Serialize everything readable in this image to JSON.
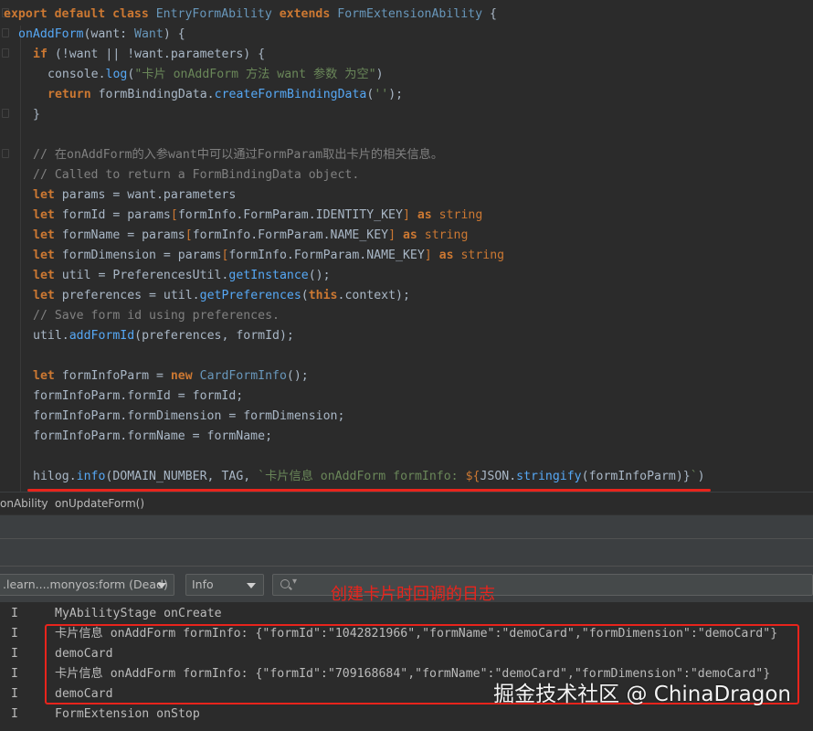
{
  "code": {
    "l1": {
      "k1": "export default class ",
      "c1": "EntryFormAbility ",
      "k2": "extends ",
      "c2": "FormExtensionAbility ",
      "p": "{"
    },
    "l2": {
      "f": "onAddForm",
      "p1": "(want: ",
      "t": "Want",
      "p2": ") {"
    },
    "l3": {
      "k": "if ",
      "p": "(!want || !want.parameters) {"
    },
    "l4": {
      "a": "console.",
      "f": "log",
      "p1": "(",
      "s": "\"卡片 onAddForm 方法 want 参数 为空\"",
      "p2": ")"
    },
    "l5": {
      "k": "return ",
      "a": "formBindingData.",
      "f": "createFormBindingData",
      "p1": "(",
      "s": "''",
      "p2": ");"
    },
    "l6": {
      "p": "}"
    },
    "l8": "// 在onAddForm的入参want中可以通过FormParam取出卡片的相关信息。",
    "l9": "// Called to return a FormBindingData object.",
    "l10": {
      "k": "let ",
      "a": "params = want.parameters"
    },
    "l11": {
      "k": "let ",
      "a": "formId = params",
      "b1": "[",
      "c": "formInfo.FormParam.IDENTITY_KEY",
      "b2": "] ",
      "k2": "as ",
      "t": "string"
    },
    "l12": {
      "k": "let ",
      "a": "formName = params",
      "b1": "[",
      "c": "formInfo.FormParam.NAME_KEY",
      "b2": "] ",
      "k2": "as ",
      "t": "string"
    },
    "l13": {
      "k": "let ",
      "a": "formDimension = params",
      "b1": "[",
      "c": "formInfo.FormParam.NAME_KEY",
      "b2": "] ",
      "k2": "as ",
      "t": "string"
    },
    "l14": {
      "k": "let ",
      "a": "util = PreferencesUtil.",
      "f": "getInstance",
      "p": "();"
    },
    "l15": {
      "k": "let ",
      "a": "preferences = util.",
      "f": "getPreferences",
      "p1": "(",
      "k2": "this",
      "p2": ".context);"
    },
    "l16": "// Save form id using preferences.",
    "l17": {
      "a": "util.",
      "f": "addFormId",
      "p": "(preferences, formId);"
    },
    "l19": {
      "k": "let ",
      "a": "formInfoParm = ",
      "k2": "new ",
      "c": "CardFormInfo",
      "p": "();"
    },
    "l20": "formInfoParm.formId = formId;",
    "l21": "formInfoParm.formDimension = formDimension;",
    "l22": "formInfoParm.formName = formName;",
    "l24": {
      "a": "hilog.",
      "f": "info",
      "p1": "(DOMAIN_NUMBER, TAG, ",
      "s1": "`卡片信息 onAddForm formInfo: ",
      "i1": "${",
      "j": "JSON.",
      "f2": "stringify",
      "i2": "(formInfoParm)}",
      "s2": "`",
      "p2": ")"
    }
  },
  "breadcrumb": {
    "item1": "onAbility",
    "sep": "›",
    "item2": "onUpdateForm()"
  },
  "toolbar": {
    "process_select": ".learn....monyos:form (Dead)",
    "level_select": "Info",
    "search_placeholder": ""
  },
  "annotation": "创建卡片时回调的日志",
  "log": [
    {
      "level": "I",
      "message": "MyAbilityStage onCreate"
    },
    {
      "level": "I",
      "message": "卡片信息 onAddForm formInfo: {\"formId\":\"1042821966\",\"formName\":\"demoCard\",\"formDimension\":\"demoCard\"}"
    },
    {
      "level": "I",
      "message": "demoCard"
    },
    {
      "level": "I",
      "message": "卡片信息 onAddForm formInfo: {\"formId\":\"709168684\",\"formName\":\"demoCard\",\"formDimension\":\"demoCard\"}"
    },
    {
      "level": "I",
      "message": "demoCard"
    },
    {
      "level": "I",
      "message": "FormExtension onStop"
    }
  ],
  "watermark": "掘金技术社区 @ ChinaDragon",
  "colors": {
    "accent_red": "#e8241c",
    "keyword": "#cc7832",
    "string": "#6a8759",
    "function": "#56a8f5",
    "comment": "#808080",
    "background": "#2b2b2b"
  }
}
